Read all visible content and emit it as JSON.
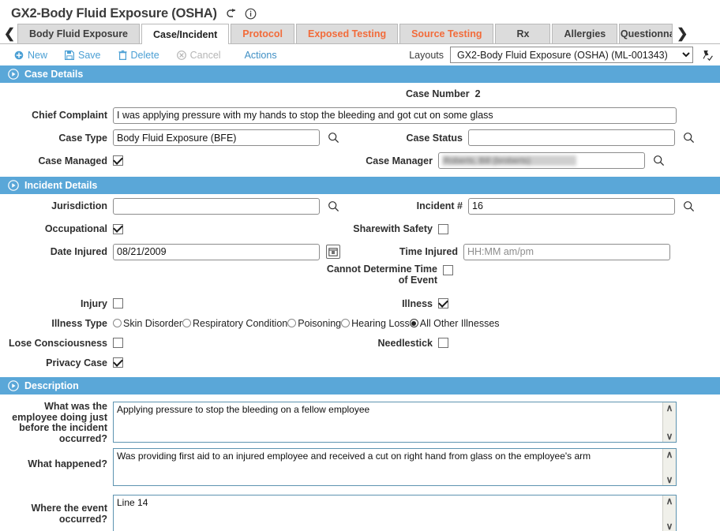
{
  "header": {
    "title": "GX2-Body Fluid Exposure (OSHA)",
    "back_icon": "return-arrow-icon",
    "info_icon": "info-icon"
  },
  "tabs": {
    "prev_arrow": "❮",
    "next_arrow": "❯",
    "items": [
      {
        "label": "Body Fluid Exposure",
        "state": "inactive",
        "color": "dark"
      },
      {
        "label": "Case/Incident",
        "state": "active",
        "color": "dark"
      },
      {
        "label": "Protocol",
        "state": "inactive",
        "color": "orange"
      },
      {
        "label": "Exposed Testing",
        "state": "inactive",
        "color": "orange"
      },
      {
        "label": "Source Testing",
        "state": "inactive",
        "color": "orange"
      },
      {
        "label": "Rx",
        "state": "inactive",
        "color": "dark"
      },
      {
        "label": "Allergies",
        "state": "inactive",
        "color": "dark"
      },
      {
        "label": "Questionna",
        "state": "inactive",
        "color": "dark"
      }
    ]
  },
  "toolbar": {
    "new_label": "New",
    "save_label": "Save",
    "delete_label": "Delete",
    "cancel_label": "Cancel",
    "actions_label": "Actions",
    "layouts_label": "Layouts",
    "layout_selected": "GX2-Body Fluid Exposure (OSHA) (ML-001343)",
    "pin_icon": "pin-check-icon"
  },
  "case_details": {
    "section_title": "Case Details",
    "case_number_label": "Case Number",
    "case_number_value": "2",
    "chief_complaint_label": "Chief Complaint",
    "chief_complaint_value": "I was applying pressure with my hands to stop the bleeding and got cut on some glass",
    "case_type_label": "Case Type",
    "case_type_value": "Body Fluid Exposure (BFE)",
    "case_status_label": "Case Status",
    "case_status_value": "",
    "case_managed_label": "Case Managed",
    "case_managed_checked": true,
    "case_manager_label": "Case Manager",
    "case_manager_value": "Roberts, Bill (broberts)"
  },
  "incident_details": {
    "section_title": "Incident Details",
    "jurisdiction_label": "Jurisdiction",
    "jurisdiction_value": "",
    "incident_num_label": "Incident #",
    "incident_num_value": "16",
    "occupational_label": "Occupational",
    "occupational_checked": true,
    "sharewith_safety_label": "Sharewith Safety",
    "sharewith_safety_checked": false,
    "date_injured_label": "Date Injured",
    "date_injured_value": "08/21/2009",
    "time_injured_label": "Time Injured",
    "time_injured_placeholder": "HH:MM am/pm",
    "cannot_determine_label": "Cannot Determine Time of Event",
    "cannot_determine_checked": false,
    "injury_label": "Injury",
    "injury_checked": false,
    "illness_label": "Illness",
    "illness_checked": true,
    "illness_type_label": "Illness Type",
    "illness_type_options": [
      {
        "label": "Skin Disorder",
        "selected": false
      },
      {
        "label": "Respiratory Condition",
        "selected": false
      },
      {
        "label": "Poisoning",
        "selected": false
      },
      {
        "label": "Hearing Loss",
        "selected": false
      },
      {
        "label": "All Other Illnesses",
        "selected": true
      }
    ],
    "lose_consciousness_label": "Lose Consciousness",
    "lose_consciousness_checked": false,
    "needlestick_label": "Needlestick",
    "needlestick_checked": false,
    "privacy_case_label": "Privacy Case",
    "privacy_case_checked": true
  },
  "description": {
    "section_title": "Description",
    "q1_label": "What was the employee doing just before the incident occurred?",
    "q1_value": "Applying pressure to stop the bleeding on a fellow employee",
    "q2_label": "What happened?",
    "q2_value": "Was providing first aid to an injured employee and received a cut on right hand from glass on the employee's arm",
    "q3_label": "Where the event occurred?",
    "q3_value": "Line 14",
    "scroll_up": "∧",
    "scroll_down": "∨"
  },
  "colors": {
    "section_header_bg": "#5aa7d8",
    "tab_orange": "#f26b3a",
    "toolbar_link": "#4a9fd4",
    "textarea_border": "#5d93b0"
  }
}
